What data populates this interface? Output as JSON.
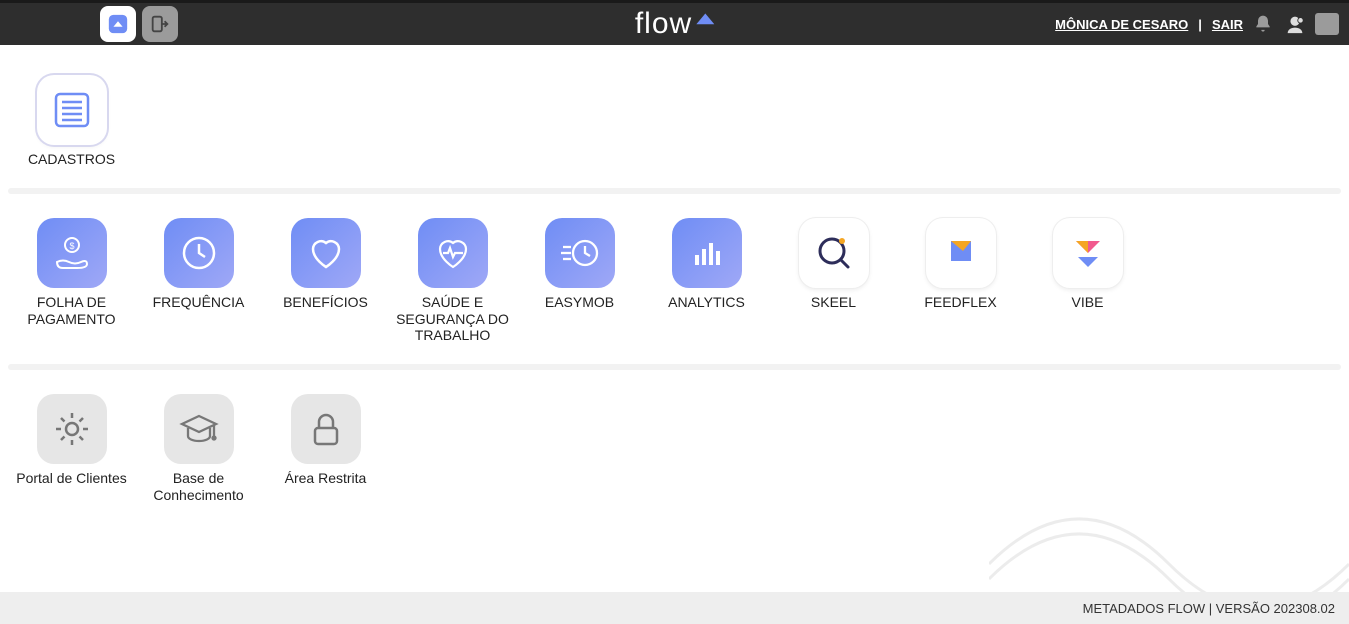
{
  "header": {
    "logo_text": "flow",
    "user_name": "MÔNICA DE CESARO",
    "logout_label": "SAIR"
  },
  "sections": [
    {
      "items": [
        {
          "label": "CADASTROS",
          "icon": "list-lines",
          "style": "outline"
        }
      ]
    },
    {
      "items": [
        {
          "label": "FOLHA DE PAGAMENTO",
          "icon": "hand-coin",
          "style": "gradient"
        },
        {
          "label": "FREQUÊNCIA",
          "icon": "clock",
          "style": "gradient"
        },
        {
          "label": "BENEFÍCIOS",
          "icon": "heart",
          "style": "gradient"
        },
        {
          "label": "SAÚDE E SEGURANÇA DO TRABALHO",
          "icon": "heart-pulse",
          "style": "gradient"
        },
        {
          "label": "EASYMOB",
          "icon": "speed-clock",
          "style": "gradient"
        },
        {
          "label": "ANALYTICS",
          "icon": "bars",
          "style": "gradient"
        },
        {
          "label": "SKEEL",
          "icon": "magnify-orange",
          "style": "white"
        },
        {
          "label": "FEEDFLEX",
          "icon": "fold-square",
          "style": "white"
        },
        {
          "label": "VIBE",
          "icon": "vibe",
          "style": "white"
        }
      ]
    },
    {
      "items": [
        {
          "label": "Portal de Clientes",
          "icon": "gear",
          "style": "grey"
        },
        {
          "label": "Base de Conhecimento",
          "icon": "grad-cap",
          "style": "grey"
        },
        {
          "label": "Área Restrita",
          "icon": "lock",
          "style": "grey"
        }
      ]
    }
  ],
  "footer": {
    "text": "METADADOS FLOW | VERSÃO 202308.02"
  }
}
